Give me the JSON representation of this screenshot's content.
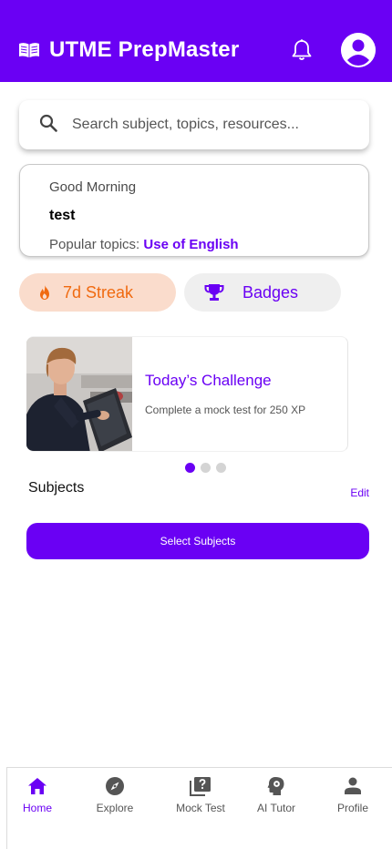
{
  "header": {
    "title": "UTME PrepMaster",
    "logo_icon": "open-book-icon",
    "notification_icon": "bell-icon",
    "profile_icon": "account-circle-icon"
  },
  "search": {
    "placeholder": "Search subject, topics, resources...",
    "icon": "search-icon"
  },
  "greeting": {
    "salutation": "Good Morning",
    "user_name": "test",
    "popular_label": "Popular topics:",
    "popular_topic": "Use of English"
  },
  "pills": {
    "streak": {
      "label": "7d Streak",
      "icon": "fire-icon"
    },
    "badges": {
      "label": "Badges",
      "icon": "trophy-icon"
    }
  },
  "challenge": {
    "title": "Today’s Challenge",
    "description": "Complete a mock test for 250 XP",
    "image": "student-with-laptop-photo"
  },
  "carousel": {
    "count": 3,
    "active_index": 0
  },
  "subjects": {
    "label": "Subjects",
    "edit_label": "Edit",
    "select_button": "Select Subjects"
  },
  "bottom_nav": {
    "items": [
      {
        "label": "Home",
        "icon": "home-icon",
        "active": true
      },
      {
        "label": "Explore",
        "icon": "compass-icon",
        "active": false
      },
      {
        "label": "Mock Test",
        "icon": "quiz-icon",
        "active": false
      },
      {
        "label": "AI Tutor",
        "icon": "brain-head-icon",
        "active": false
      },
      {
        "label": "Profile",
        "icon": "person-icon",
        "active": false
      }
    ]
  },
  "colors": {
    "brand": "#6a00f4",
    "streak_bg": "#fadccc",
    "streak_fg": "#f06a10",
    "pill_bg": "#efefef"
  }
}
